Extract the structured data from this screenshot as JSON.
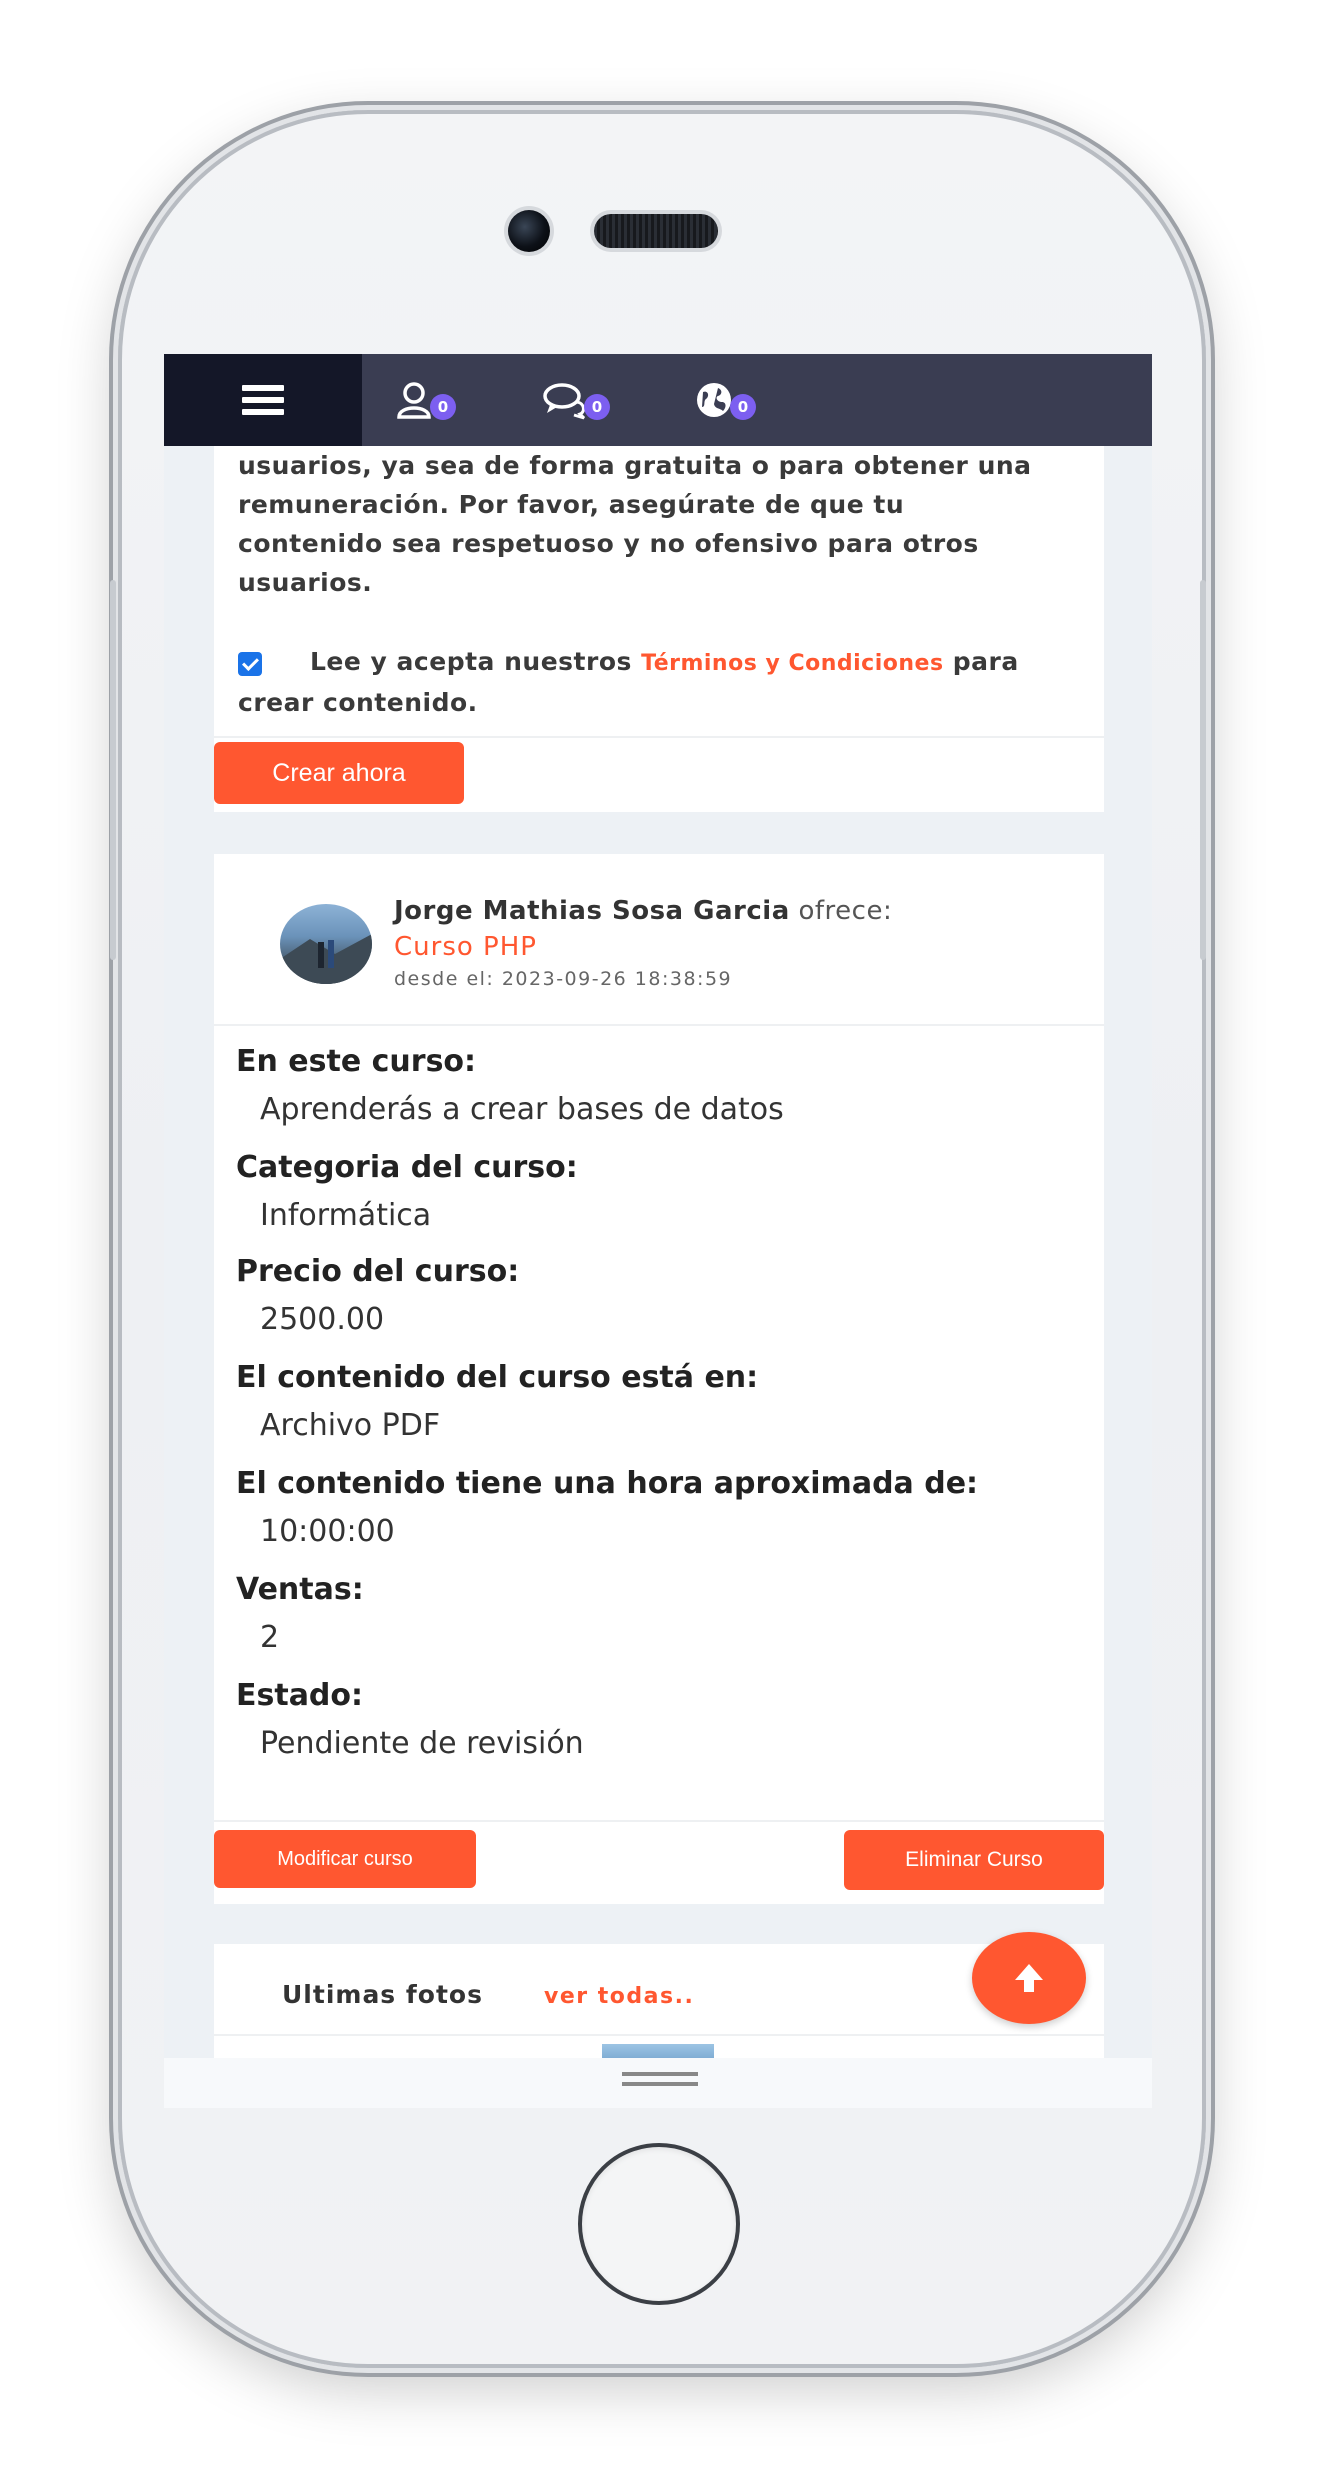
{
  "navbar": {
    "users_count": "0",
    "messages_count": "0",
    "world_count": "0"
  },
  "terms": {
    "text_lines": [
      "usuarios, ya sea de forma gratuita o para obtener una",
      "remuneración. Por favor, asegúrate de que tu",
      "contenido sea respetuoso y no ofensivo para otros",
      "usuarios."
    ],
    "accept_prefix": "Lee y acepta nuestros",
    "accept_link": "Términos y Condiciones",
    "accept_suffix": "para",
    "accept_line2": "crear contenido.",
    "create_button": "Crear ahora",
    "checkbox_checked": true
  },
  "course": {
    "author": "Jorge Mathias Sosa Garcia",
    "offers": "ofrece:",
    "title": "Curso PHP",
    "date": "desde el: 2023-09-26 18:38:59",
    "details": [
      {
        "label": "En este curso:",
        "value": "Aprenderás a crear bases de datos"
      },
      {
        "label": "Categoria del curso:",
        "value": "Informática"
      },
      {
        "label": "Precio del curso:",
        "value": "2500.00"
      },
      {
        "label": "El contenido del curso está en:",
        "value": "Archivo PDF"
      },
      {
        "label": "El contenido tiene una hora aproximada de:",
        "value": "10:00:00"
      },
      {
        "label": "Ventas:",
        "value": "2"
      },
      {
        "label": "Estado:",
        "value": "Pendiente de revisión"
      }
    ],
    "modify_button": "Modificar curso",
    "delete_button": "Eliminar Curso"
  },
  "photos": {
    "title": "Ultimas fotos",
    "see_all": "ver todas.."
  },
  "colors": {
    "accent": "#ff5730",
    "nav_bg": "#3a3d52",
    "nav_toggle_bg": "#141728",
    "badge": "#7c5ff0"
  }
}
